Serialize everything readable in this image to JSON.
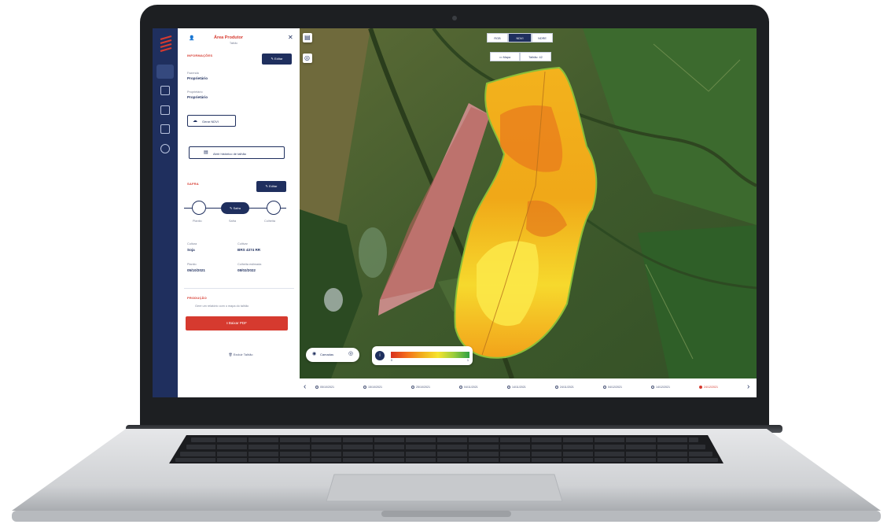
{
  "panel": {
    "title": "Área Produtor",
    "subtitle": "Talhão",
    "info_section": "INFORMAÇÕES",
    "edit_label": "✎ Editar",
    "fields": [
      {
        "label": "Fazenda",
        "value": "Proprietário"
      },
      {
        "label": "Proprietário",
        "value": "Proprietário"
      }
    ],
    "view_btn": "Gerar NDVI",
    "history_btn": "Abrir histórico de talhão",
    "status_section": "SAFRA",
    "status_edit": "✎ Editar",
    "steps": [
      "Plantio",
      "Safra",
      "Colheita"
    ],
    "active_step": "Safra",
    "crop_fields": [
      {
        "label": "Cultura",
        "value": "Soja"
      },
      {
        "label": "Cultivar",
        "value": "BRS 4374 RR"
      },
      {
        "label": "Plantio",
        "value": "05/10/2021"
      },
      {
        "label": "Colheita estimada",
        "value": "08/02/2022"
      }
    ],
    "analysis_section": "PRODUÇÃO",
    "analysis_note": "Gere um relatório com o mapa do talhão",
    "download_btn": "Baixar PDF",
    "delete_btn": "Excluir Talhão"
  },
  "map": {
    "layers": [
      "RGB",
      "NDVI",
      "NDRE"
    ],
    "active_layer": "NDVI",
    "sublayers": [
      "Mapa",
      "Talhão: 42"
    ],
    "legend_toggle": "Camadas",
    "scale_min": "0",
    "scale_max": "1",
    "dates": [
      "05/10/2021",
      "15/10/2021",
      "25/10/2021",
      "04/11/2021",
      "14/11/2021",
      "24/11/2021",
      "04/12/2021",
      "14/12/2021",
      "24/12/2021"
    ],
    "selected_date": "24/12/2021"
  },
  "colors": {
    "navy": "#1f2f5e",
    "red": "#d63a2f",
    "ndvi_high": "#2ea043",
    "ndvi_low": "#d7301f"
  }
}
